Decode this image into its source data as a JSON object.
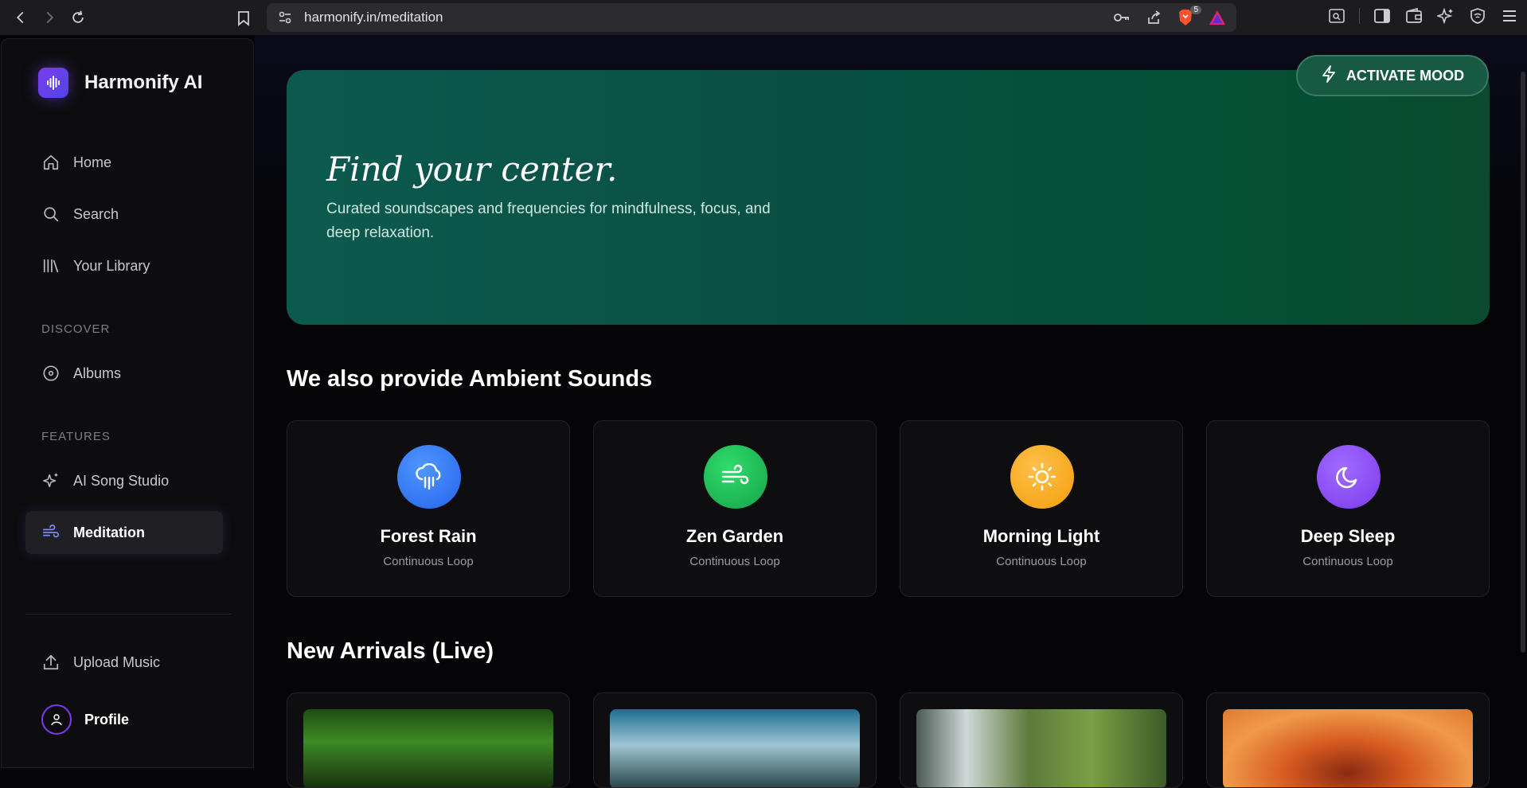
{
  "browser": {
    "url": "harmonify.in/meditation",
    "shields_count": "5"
  },
  "sidebar": {
    "brand": "Harmonify AI",
    "nav": [
      {
        "label": "Home",
        "icon": "home-icon"
      },
      {
        "label": "Search",
        "icon": "search-icon"
      },
      {
        "label": "Your Library",
        "icon": "library-icon"
      }
    ],
    "discover_label": "DISCOVER",
    "discover": [
      {
        "label": "Albums",
        "icon": "disc-icon"
      }
    ],
    "features_label": "FEATURES",
    "features": [
      {
        "label": "AI Song Studio",
        "icon": "sparkles-icon"
      },
      {
        "label": "Meditation",
        "icon": "wind-icon",
        "active": true
      }
    ],
    "upload_label": "Upload Music",
    "profile_label": "Profile"
  },
  "hero": {
    "title": "Find your center.",
    "subtitle": "Curated soundscapes and frequencies for mindfulness, focus, and deep relaxation.",
    "activate_label": "ACTIVATE MOOD"
  },
  "ambient": {
    "title": "We also provide Ambient Sounds",
    "cards": [
      {
        "title": "Forest Rain",
        "subtitle": "Continuous Loop",
        "icon": "cloud-rain-icon",
        "color": "#3b82f6"
      },
      {
        "title": "Zen Garden",
        "subtitle": "Continuous Loop",
        "icon": "wind-icon",
        "color": "#22c55e"
      },
      {
        "title": "Morning Light",
        "subtitle": "Continuous Loop",
        "icon": "sun-icon",
        "color": "#f59e0b"
      },
      {
        "title": "Deep Sleep",
        "subtitle": "Continuous Loop",
        "icon": "moon-icon",
        "color": "#8b5cf6"
      }
    ]
  },
  "arrivals": {
    "title": "New Arrivals (Live)"
  },
  "colors": {
    "accent": "#7c3aed",
    "hero": "#0a5043"
  }
}
